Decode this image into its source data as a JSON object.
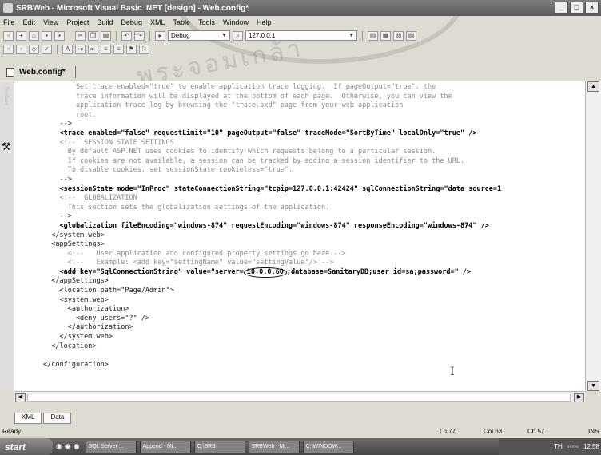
{
  "window": {
    "title": "SRBWeb - Microsoft Visual Basic .NET [design] - Web.config*",
    "minimize": "_",
    "maximize": "□",
    "close": "×"
  },
  "menu": [
    "File",
    "Edit",
    "View",
    "Project",
    "Build",
    "Debug",
    "XML",
    "Table",
    "Tools",
    "Window",
    "Help"
  ],
  "toolbar": {
    "config_combo": "Debug",
    "server_combo": "127.0.0.1"
  },
  "tab": {
    "label": "Web.config*"
  },
  "code_lines": [
    {
      "t": "        Set trace enabled=\"true\" to enable application trace logging.  If pageOutput=\"true\", the",
      "cls": "c"
    },
    {
      "t": "        trace information will be displayed at the bottom of each page.  Otherwise, you can view the",
      "cls": "c"
    },
    {
      "t": "        application trace log by browsing the \"trace.axd\" page from your web application",
      "cls": "c"
    },
    {
      "t": "        root.",
      "cls": "c"
    },
    {
      "t": "    -->",
      "cls": "k"
    },
    {
      "t": "    <trace enabled=\"false\" requestLimit=\"10\" pageOutput=\"false\" traceMode=\"SortByTime\" localOnly=\"true\" />",
      "cls": "v"
    },
    {
      "t": "    <!--  SESSION STATE SETTINGS",
      "cls": "c"
    },
    {
      "t": "      By default ASP.NET uses cookies to identify which requests belong to a particular session.",
      "cls": "c"
    },
    {
      "t": "      If cookies are not available, a session can be tracked by adding a session identifier to the URL.",
      "cls": "c"
    },
    {
      "t": "      To disable cookies, set sessionState cookieless=\"true\".",
      "cls": "c"
    },
    {
      "t": "    -->",
      "cls": "k"
    },
    {
      "t": "    <sessionState mode=\"InProc\" stateConnectionString=\"tcpip=127.0.0.1:42424\" sqlConnectionString=\"data source=1",
      "cls": "v"
    },
    {
      "t": "    <!--  GLOBALIZATION",
      "cls": "c"
    },
    {
      "t": "      This section sets the globalization settings of the application.",
      "cls": "c"
    },
    {
      "t": "    -->",
      "cls": "k"
    },
    {
      "t": "    <globalization fileEncoding=\"windows-874\" requestEncoding=\"windows-874\" responseEncoding=\"windows-874\" />",
      "cls": "v"
    },
    {
      "t": "  </system.web>",
      "cls": "k"
    },
    {
      "t": "  <appSettings>",
      "cls": "k"
    },
    {
      "t": "      <!--   User application and configured property settings go here.-->",
      "cls": "c"
    },
    {
      "t": "      <!--   Example: <add key=\"settingName\" value=\"settingValue\"/> -->",
      "cls": "c"
    },
    {
      "t": "    <add key=\"SqlConnectionString\" value=\"server=",
      "cls": "v",
      "circled": "10.0.0.60",
      "rest": ";database=SanitaryDB;user id=sa;password=\" />"
    },
    {
      "t": "  </appSettings>",
      "cls": "k"
    },
    {
      "t": "    <location path=\"Page/Admin\">",
      "cls": "k"
    },
    {
      "t": "    <system.web>",
      "cls": "k"
    },
    {
      "t": "      <authorization>",
      "cls": "k"
    },
    {
      "t": "        <deny users=\"?\" />",
      "cls": "k"
    },
    {
      "t": "      </authorization>",
      "cls": "k"
    },
    {
      "t": "    </system.web>",
      "cls": "k"
    },
    {
      "t": "  </location>",
      "cls": "k"
    },
    {
      "t": "",
      "cls": "k"
    },
    {
      "t": "</configuration>",
      "cls": "k"
    }
  ],
  "bottom_tabs": [
    "XML",
    "Data"
  ],
  "status": {
    "left": "Ready",
    "ln": "Ln 77",
    "col": "Col 63",
    "ch": "Ch 57",
    "mode": "INS"
  },
  "taskbar": {
    "start": "start",
    "tasks": [
      "SQL Server ...",
      "Append - Mi...",
      "C:\\SRB",
      "SRBWeb - Mi...",
      "C:\\WINDOW..."
    ],
    "tray_lang": "TH",
    "clock": "12:58"
  }
}
